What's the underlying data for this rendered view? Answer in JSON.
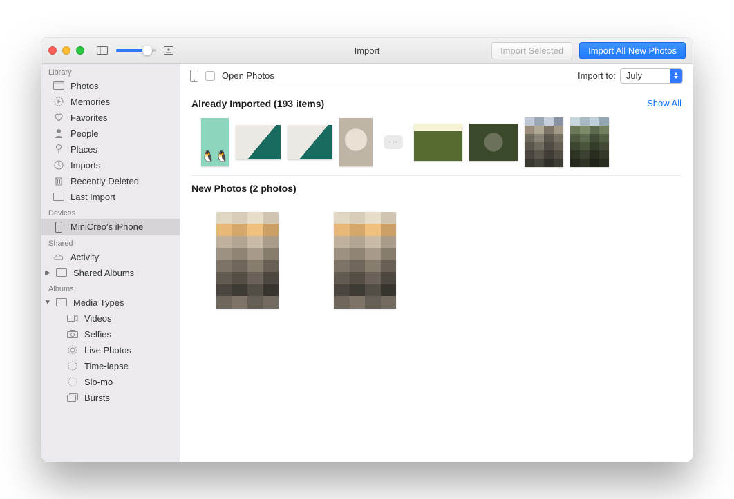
{
  "window": {
    "title": "Import"
  },
  "toolbar": {
    "import_selected": "Import Selected",
    "import_all": "Import All New Photos"
  },
  "sidebar": {
    "groups": {
      "library": "Library",
      "devices": "Devices",
      "shared": "Shared",
      "albums": "Albums"
    },
    "library": [
      {
        "label": "Photos"
      },
      {
        "label": "Memories"
      },
      {
        "label": "Favorites"
      },
      {
        "label": "People"
      },
      {
        "label": "Places"
      },
      {
        "label": "Imports"
      },
      {
        "label": "Recently Deleted"
      },
      {
        "label": "Last Import"
      }
    ],
    "devices": [
      {
        "label": "MiniCreo's iPhone"
      }
    ],
    "shared": [
      {
        "label": "Activity"
      },
      {
        "label": "Shared Albums"
      }
    ],
    "albums": [
      {
        "label": "Media Types"
      }
    ],
    "media_types": [
      {
        "label": "Videos"
      },
      {
        "label": "Selfies"
      },
      {
        "label": "Live Photos"
      },
      {
        "label": "Time-lapse"
      },
      {
        "label": "Slo-mo"
      },
      {
        "label": "Bursts"
      }
    ]
  },
  "import_bar": {
    "open_photos_label": "Open Photos",
    "import_to_label": "Import to:",
    "import_to_value": "July"
  },
  "sections": {
    "already": {
      "title": "Already Imported (193 items)",
      "show_all": "Show All"
    },
    "new": {
      "title": "New Photos (2 photos)"
    }
  }
}
